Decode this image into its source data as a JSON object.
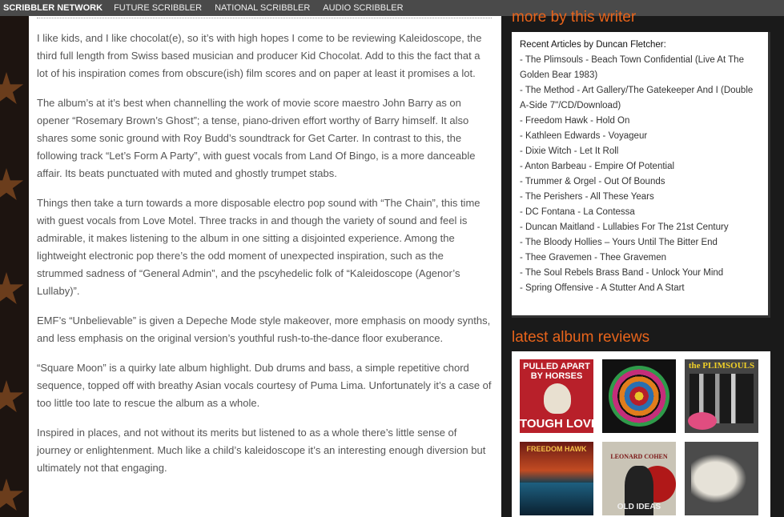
{
  "nav": {
    "brand": "SCRIBBLER NETWORK",
    "items": [
      "FUTURE SCRIBBLER",
      "NATIONAL SCRIBBLER",
      "AUDIO SCRIBBLER"
    ]
  },
  "article": {
    "paragraphs": [
      "I like kids, and I like chocolat(e), so it’s with high hopes I come to be reviewing Kaleidoscope, the third full length from Swiss based musician and producer Kid Chocolat. Add to this the fact that a lot of his inspiration comes from obscure(ish) film scores and on paper at least it promises a lot.",
      "The album’s at it’s best when channelling the work of movie score maestro John Barry as on opener “Rosemary Brown’s Ghost”; a tense, piano-driven effort worthy of Barry himself. It also shares some sonic ground with Roy Budd’s soundtrack for Get Carter. In contrast to this, the following track “Let’s Form A Party”, with guest vocals from Land Of Bingo, is a more danceable affair. Its beats punctuated with muted and ghostly trumpet stabs.",
      "Things then take a turn towards a more disposable electro pop sound with “The Chain”, this time with guest vocals from Love Motel. Three tracks in and though the variety of sound and feel is admirable, it makes listening to the album in one sitting a disjointed experience. Among the lightweight electronic pop there’s the odd moment of unexpected inspiration, such as the strummed sadness of “General Admin”, and the pscyhedelic folk of “Kaleidoscope (Agenor’s Lullaby)”.",
      "EMF’s “Unbelievable” is given a Depeche Mode style makeover, more emphasis on moody synths, and less emphasis on the original version’s youthful rush-to-the-dance floor exuberance.",
      "“Square Moon” is a quirky late album highlight. Dub drums and bass, a simple repetitive chord sequence, topped off with breathy Asian vocals courtesy of Puma Lima. Unfortunately it’s a case of too little too late to rescue the album as a whole.",
      "Inspired in places, and not without its merits but listened to as a whole there’s little sense of journey or enlightenment. Much like a child’s kaleidoscope it’s an interesting enough diversion but ultimately not that engaging."
    ]
  },
  "more_by_writer": {
    "title": "more by this writer",
    "heading": "Recent Articles by Duncan Fletcher:",
    "links": [
      "- The Plimsouls - Beach Town Confidential (Live At The Golden Bear 1983)",
      "- The Method - Art Gallery/The Gatekeeper And I (Double A-Side 7\"/CD/Download)",
      "- Freedom Hawk - Hold On",
      "- Kathleen Edwards - Voyageur",
      "- Dixie Witch - Let It Roll",
      "- Anton Barbeau - Empire Of Potential",
      "- Trummer & Orgel - Out Of Bounds",
      "- The Perishers - All These Years",
      "- DC Fontana - La Contessa",
      "- Duncan Maitland - Lullabies For The 21st Century",
      "- The Bloody Hollies – Yours Until The Bitter End",
      "- Thee Gravemen - Thee Gravemen",
      "- The Soul Rebels Brass Band - Unlock Your Mind",
      "- Spring Offensive - A Stutter And A Start"
    ]
  },
  "latest_reviews": {
    "title": "latest album reviews",
    "album1": {
      "line1": "PULLED APART",
      "line2": "BY HORSES",
      "line3": "TOUGH LOVE"
    },
    "album3": {
      "line1": "the PLIMSOULS"
    },
    "album4": {
      "line1": "FREEDOM HAWK"
    },
    "album5": {
      "line1": "LEONARD COHEN",
      "line2": "OLD IDEAS"
    }
  }
}
